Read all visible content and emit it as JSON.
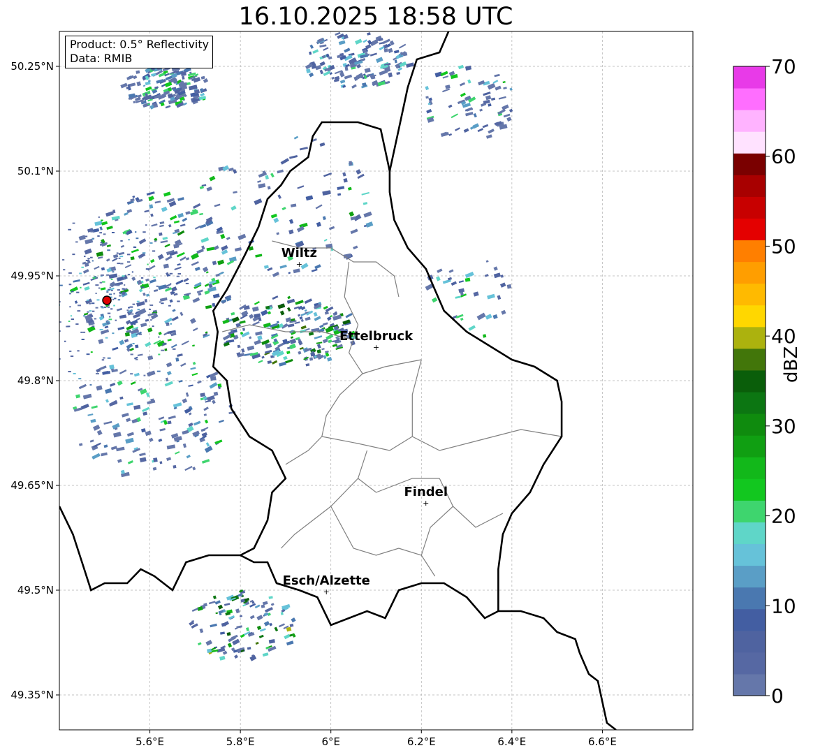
{
  "title": "16.10.2025 18:58 UTC",
  "info": {
    "product": "Product: 0.5° Reflectivity",
    "data": "Data: RMIB"
  },
  "map": {
    "lon_range": [
      5.4,
      6.8
    ],
    "lat_range": [
      49.3,
      50.3
    ],
    "lon_ticks": [
      {
        "value": 5.6,
        "label": "5.6°E"
      },
      {
        "value": 5.8,
        "label": "5.8°E"
      },
      {
        "value": 6.0,
        "label": "6°E"
      },
      {
        "value": 6.2,
        "label": "6.2°E"
      },
      {
        "value": 6.4,
        "label": "6.4°E"
      },
      {
        "value": 6.6,
        "label": "6.6°E"
      }
    ],
    "lat_ticks": [
      {
        "value": 50.25,
        "label": "50.25°N"
      },
      {
        "value": 50.1,
        "label": "50.1°N"
      },
      {
        "value": 49.95,
        "label": "49.95°N"
      },
      {
        "value": 49.8,
        "label": "49.8°N"
      },
      {
        "value": 49.65,
        "label": "49.65°N"
      },
      {
        "value": 49.5,
        "label": "49.5°N"
      },
      {
        "value": 49.35,
        "label": "49.35°N"
      }
    ],
    "grid": true,
    "radar_site": {
      "lon": 5.505,
      "lat": 49.915
    },
    "cities": [
      {
        "name": "Wiltz",
        "lon": 5.93,
        "lat": 49.967
      },
      {
        "name": "Ettelbruck",
        "lon": 6.1,
        "lat": 49.848
      },
      {
        "name": "Findel",
        "lon": 6.21,
        "lat": 49.625
      },
      {
        "name": "Esch/Alzette",
        "lon": 5.99,
        "lat": 49.498
      }
    ],
    "border": [
      [
        5.4,
        49.62
      ],
      [
        5.43,
        49.58
      ],
      [
        5.45,
        49.54
      ],
      [
        5.47,
        49.5
      ],
      [
        5.5,
        49.51
      ],
      [
        5.55,
        49.51
      ],
      [
        5.58,
        49.53
      ],
      [
        5.61,
        49.52
      ],
      [
        5.65,
        49.5
      ],
      [
        5.68,
        49.54
      ],
      [
        5.73,
        49.55
      ],
      [
        5.77,
        49.55
      ],
      [
        5.8,
        49.55
      ],
      [
        5.83,
        49.54
      ],
      [
        5.86,
        49.54
      ],
      [
        5.88,
        49.51
      ],
      [
        5.93,
        49.5
      ],
      [
        5.97,
        49.49
      ],
      [
        6.0,
        49.45
      ],
      [
        6.04,
        49.46
      ],
      [
        6.08,
        49.47
      ],
      [
        6.12,
        49.46
      ],
      [
        6.15,
        49.5
      ],
      [
        6.2,
        49.51
      ],
      [
        6.25,
        49.51
      ],
      [
        6.3,
        49.49
      ],
      [
        6.34,
        49.46
      ],
      [
        6.37,
        49.47
      ],
      [
        6.42,
        49.47
      ],
      [
        6.47,
        49.46
      ],
      [
        6.5,
        49.44
      ],
      [
        6.54,
        49.43
      ],
      [
        6.55,
        49.41
      ],
      [
        6.57,
        49.38
      ],
      [
        6.59,
        49.37
      ],
      [
        6.6,
        49.34
      ],
      [
        6.61,
        49.31
      ],
      [
        6.63,
        49.3
      ]
    ],
    "border_lux_east": [
      [
        6.37,
        49.47
      ],
      [
        6.37,
        49.53
      ],
      [
        6.38,
        49.58
      ],
      [
        6.4,
        49.61
      ],
      [
        6.44,
        49.64
      ],
      [
        6.47,
        49.68
      ],
      [
        6.51,
        49.72
      ],
      [
        6.51,
        49.77
      ],
      [
        6.5,
        49.8
      ],
      [
        6.45,
        49.82
      ],
      [
        6.4,
        49.83
      ],
      [
        6.35,
        49.85
      ],
      [
        6.3,
        49.87
      ],
      [
        6.25,
        49.9
      ],
      [
        6.23,
        49.93
      ],
      [
        6.21,
        49.96
      ],
      [
        6.17,
        49.99
      ],
      [
        6.14,
        50.03
      ],
      [
        6.13,
        50.07
      ],
      [
        6.13,
        50.1
      ],
      [
        6.12,
        50.13
      ],
      [
        6.11,
        50.16
      ],
      [
        6.06,
        50.17
      ],
      [
        6.03,
        50.17
      ],
      [
        5.98,
        50.17
      ],
      [
        5.96,
        50.15
      ],
      [
        5.95,
        50.12
      ],
      [
        5.91,
        50.1
      ],
      [
        5.89,
        50.08
      ],
      [
        5.86,
        50.06
      ],
      [
        5.84,
        50.02
      ],
      [
        5.81,
        49.98
      ],
      [
        5.77,
        49.93
      ],
      [
        5.74,
        49.9
      ],
      [
        5.75,
        49.87
      ],
      [
        5.74,
        49.82
      ],
      [
        5.77,
        49.8
      ],
      [
        5.78,
        49.76
      ],
      [
        5.82,
        49.72
      ],
      [
        5.87,
        49.7
      ],
      [
        5.9,
        49.66
      ],
      [
        5.87,
        49.64
      ],
      [
        5.86,
        49.6
      ],
      [
        5.83,
        49.56
      ],
      [
        5.8,
        49.55
      ]
    ],
    "border_north": [
      [
        6.13,
        50.1
      ],
      [
        6.15,
        50.16
      ],
      [
        6.17,
        50.22
      ],
      [
        6.19,
        50.26
      ],
      [
        6.24,
        50.27
      ],
      [
        6.26,
        50.3
      ]
    ],
    "cantons": [
      [
        [
          5.87,
          50.0
        ],
        [
          5.93,
          49.99
        ],
        [
          6.0,
          49.99
        ],
        [
          6.05,
          49.97
        ],
        [
          6.1,
          49.97
        ],
        [
          6.14,
          49.95
        ],
        [
          6.15,
          49.92
        ]
      ],
      [
        [
          6.04,
          49.97
        ],
        [
          6.03,
          49.92
        ],
        [
          6.06,
          49.88
        ],
        [
          6.04,
          49.84
        ],
        [
          6.07,
          49.81
        ],
        [
          6.12,
          49.82
        ],
        [
          6.2,
          49.83
        ]
      ],
      [
        [
          5.76,
          49.87
        ],
        [
          5.82,
          49.88
        ],
        [
          5.9,
          49.87
        ],
        [
          5.98,
          49.87
        ],
        [
          6.04,
          49.86
        ]
      ],
      [
        [
          6.07,
          49.81
        ],
        [
          6.02,
          49.78
        ],
        [
          5.99,
          49.75
        ],
        [
          5.98,
          49.72
        ],
        [
          5.95,
          49.7
        ],
        [
          5.9,
          49.68
        ]
      ],
      [
        [
          6.2,
          49.83
        ],
        [
          6.18,
          49.78
        ],
        [
          6.18,
          49.72
        ],
        [
          6.24,
          49.7
        ],
        [
          6.3,
          49.71
        ],
        [
          6.36,
          49.72
        ],
        [
          6.42,
          49.73
        ],
        [
          6.51,
          49.72
        ]
      ],
      [
        [
          5.98,
          49.72
        ],
        [
          6.06,
          49.71
        ],
        [
          6.13,
          49.7
        ],
        [
          6.18,
          49.72
        ]
      ],
      [
        [
          6.08,
          49.7
        ],
        [
          6.06,
          49.66
        ],
        [
          6.1,
          49.64
        ],
        [
          6.14,
          49.65
        ],
        [
          6.18,
          49.66
        ],
        [
          6.24,
          49.66
        ]
      ],
      [
        [
          6.24,
          49.66
        ],
        [
          6.27,
          49.62
        ],
        [
          6.32,
          49.59
        ],
        [
          6.38,
          49.61
        ]
      ],
      [
        [
          6.06,
          49.66
        ],
        [
          6.0,
          49.62
        ],
        [
          5.96,
          49.6
        ],
        [
          5.92,
          49.58
        ],
        [
          5.89,
          49.56
        ]
      ],
      [
        [
          6.0,
          49.62
        ],
        [
          6.05,
          49.56
        ],
        [
          6.1,
          49.55
        ],
        [
          6.15,
          49.56
        ],
        [
          6.2,
          49.55
        ],
        [
          6.23,
          49.52
        ]
      ],
      [
        [
          6.27,
          49.62
        ],
        [
          6.22,
          49.59
        ],
        [
          6.2,
          49.55
        ]
      ]
    ],
    "echo_regions": [
      {
        "lon": 5.63,
        "lat": 50.22,
        "rlon": 0.1,
        "rlat": 0.03,
        "n": 140,
        "max": 25
      },
      {
        "lon": 6.05,
        "lat": 50.26,
        "rlon": 0.12,
        "rlat": 0.04,
        "n": 130,
        "max": 20
      },
      {
        "lon": 6.3,
        "lat": 50.2,
        "rlon": 0.1,
        "rlat": 0.06,
        "n": 70,
        "max": 25
      },
      {
        "lon": 5.9,
        "lat": 50.05,
        "rlon": 0.2,
        "rlat": 0.1,
        "n": 90,
        "max": 28
      },
      {
        "lon": 5.6,
        "lat": 49.95,
        "rlon": 0.18,
        "rlat": 0.12,
        "n": 260,
        "max": 30
      },
      {
        "lon": 5.9,
        "lat": 49.87,
        "rlon": 0.15,
        "rlat": 0.05,
        "n": 200,
        "max": 38
      },
      {
        "lon": 5.6,
        "lat": 49.75,
        "rlon": 0.18,
        "rlat": 0.09,
        "n": 150,
        "max": 25
      },
      {
        "lon": 5.8,
        "lat": 49.45,
        "rlon": 0.12,
        "rlat": 0.05,
        "n": 110,
        "max": 42
      },
      {
        "lon": 6.3,
        "lat": 49.93,
        "rlon": 0.1,
        "rlat": 0.07,
        "n": 35,
        "max": 25
      }
    ]
  },
  "colorbar": {
    "label": "dBZ",
    "min": 0,
    "max": 70,
    "ticks": [
      0,
      10,
      20,
      30,
      40,
      50,
      60,
      70
    ],
    "colors": [
      "#6577aa",
      "#5668a3",
      "#4f63a0",
      "#435ea2",
      "#4a78b0",
      "#5a9ec6",
      "#66c2d9",
      "#5fd6c8",
      "#3ed56e",
      "#12c71f",
      "#12b81a",
      "#109f12",
      "#0f8b0e",
      "#0c7612",
      "#0a5e0a",
      "#42760a",
      "#acb20e",
      "#ffd700",
      "#ffba00",
      "#ff9e00",
      "#ff7f00",
      "#e40000",
      "#c80000",
      "#a80000",
      "#7a0000",
      "#ffe2ff",
      "#ffb3ff",
      "#ff6eff",
      "#e83ae8"
    ]
  }
}
